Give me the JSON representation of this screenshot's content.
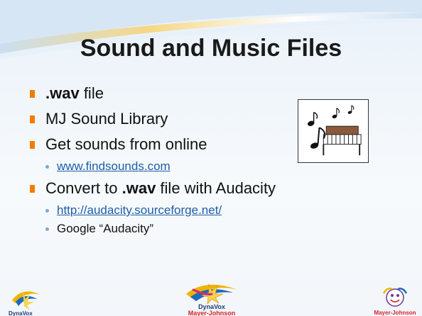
{
  "slide": {
    "title": "Sound and Music Files",
    "bullets": [
      {
        "prefix": "",
        "strong": ".wav",
        "suffix": " file"
      },
      {
        "text": "MJ Sound Library"
      },
      {
        "text": "Get sounds from online"
      },
      {
        "sub": "www.findsounds.com"
      },
      {
        "text": "Convert to ",
        "strong": ".wav",
        "suffix": " file with Audacity"
      },
      {
        "sub_link": "http://audacity.sourceforge.net/"
      },
      {
        "sub_text": "Google “Audacity”"
      }
    ]
  },
  "logos": {
    "left": "DynaVox",
    "center_top": "DynaVox",
    "center_bottom": "Mayer-Johnson",
    "right": "Mayer-Johnson"
  },
  "colors": {
    "bullet_orange": "#f07c00",
    "link_blue": "#1e5ea8",
    "sub_bullet_blue": "#7fa7cc"
  },
  "icons": {
    "clipart": "music-notes-piano-icon"
  }
}
